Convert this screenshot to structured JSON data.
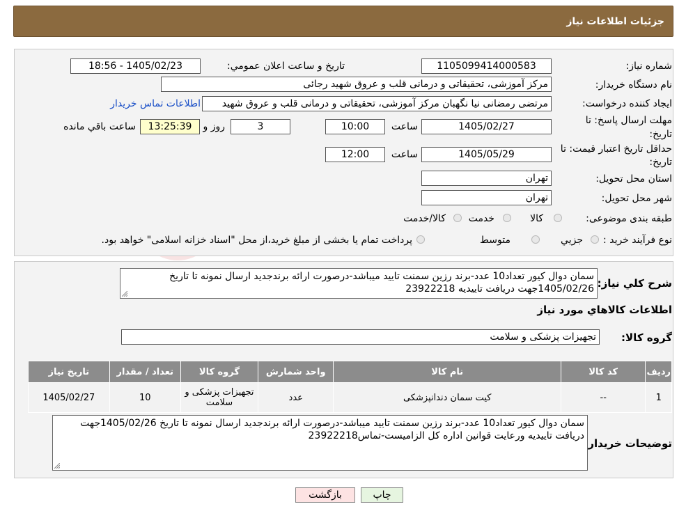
{
  "header": {
    "title": "جزئیات اطلاعات نیاز"
  },
  "need": {
    "number_label": "شماره نیاز:",
    "number_value": "1105099414000583",
    "announce_label": "تاريخ و ساعت اعلان عمومي:",
    "announce_value": "1405/02/23 - 18:56",
    "buyer_org_label": "نام دستگاه خريدار:",
    "buyer_org_value": "مرکز آموزشی، تحقیقاتی و درمانی قلب و عروق شهید رجائی",
    "creator_label": "ايجاد کننده درخواست:",
    "creator_value": "مرتضی رمضانی نیا نگهبان مرکز آموزشی، تحقیقاتی و درمانی قلب و عروق شهید",
    "contact_link": "اطلاعات تماس خريدار",
    "deadline_label_1": "مهلت ارسال پاسخ: تا",
    "deadline_label_2": "تاريخ:",
    "deadline_date": "1405/02/27",
    "time_label": "ساعت",
    "deadline_time": "10:00",
    "days_value": "3",
    "days_label": "روز و",
    "remaining_value": "13:25:39",
    "remaining_label": "ساعت باقي مانده",
    "validity_label_1": "حداقل تاريخ اعتبار قيمت: تا",
    "validity_label_2": "تاريخ:",
    "validity_date": "1405/05/29",
    "validity_time_label": "ساعت",
    "validity_time": "12:00",
    "province_label": "استان محل تحويل:",
    "province_value": "تهران",
    "city_label": "شهر محل تحويل:",
    "city_value": "تهران",
    "category_label": "طبقه بندی موضوعی:",
    "category_options": [
      "کالا",
      "خدمت",
      "کالا/خدمت"
    ],
    "process_label": "نوع فرآيند خريد :",
    "process_options": [
      "جزيي",
      "متوسط"
    ],
    "process_note": "پرداخت تمام يا بخشی از مبلغ خريد،از محل \"اسناد خزانه اسلامی\" خواهد بود."
  },
  "summary": {
    "label": "شرح کلي نياز:",
    "text": "سمان دوال کیور تعداد10 عدد-برند رزین سمنت تایید میباشد-درصورت ارائه برندجدید ارسال نمونه تا تاریخ 1405/02/26جهت دریافت تاییدیه 23922218"
  },
  "goods": {
    "section_title": "اطلاعات کالاهاي مورد نياز",
    "group_label": "گروه کالا:",
    "group_value": "تجهیزات پزشکی و سلامت",
    "columns": [
      "رديف",
      "کد کالا",
      "نام کالا",
      "واحد شمارش",
      "گروه کالا",
      "تعداد / مقدار",
      "تاريخ نياز"
    ],
    "rows": [
      {
        "index": "1",
        "code": "--",
        "name": "کیت سمان دندانپزشکی",
        "unit": "عدد",
        "group": "تجهیزات پزشکی و سلامت",
        "qty": "10",
        "date": "1405/02/27"
      }
    ]
  },
  "buyer_notes": {
    "label": "توضيحات خريدار:",
    "text": "سمان دوال کیور تعداد10 عدد-برند رزین سمنت تایید میباشد-درصورت ارائه برندجدید ارسال نمونه تا تاریخ 1405/02/26جهت دریافت تاییدیه ورعایت قوانین اداره کل الزامیست-تماس23922218"
  },
  "buttons": {
    "print": "چاپ",
    "back": "بازگشت"
  },
  "watermark_text": "AriaTender.neT",
  "colors": {
    "header_bg": "#8b6a3f",
    "table_header": "#8c8c8c",
    "link": "#1a4fc7",
    "back_btn": "#fde3e3",
    "print_btn": "#e6f5e0"
  }
}
